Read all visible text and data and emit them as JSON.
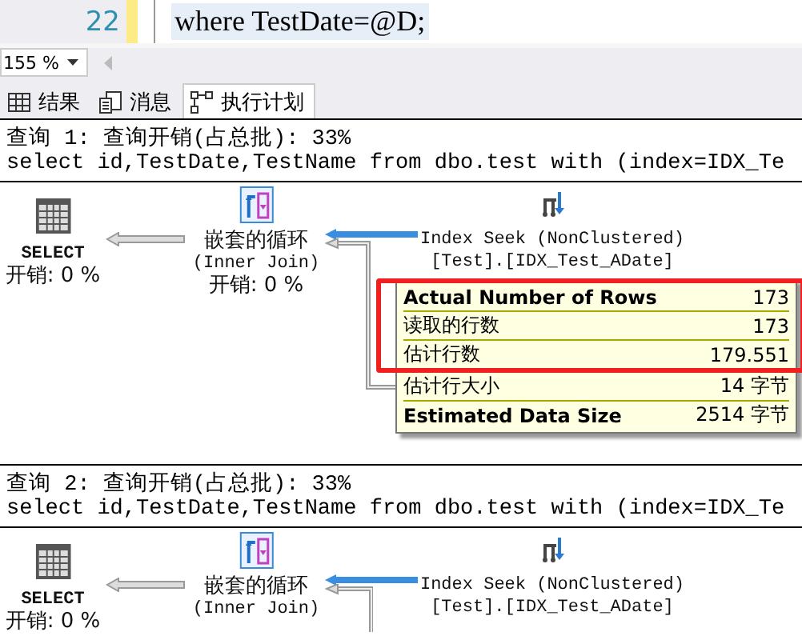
{
  "editor": {
    "line_number": "22",
    "code": "where TestDate=@D;"
  },
  "zoom": {
    "value": "155 %"
  },
  "tabs": [
    {
      "kind": "grid",
      "label": "结果",
      "selected": false
    },
    {
      "kind": "message",
      "label": "消息",
      "selected": false
    },
    {
      "kind": "plan",
      "label": "执行计划",
      "selected": true
    }
  ],
  "queries": [
    {
      "header": "查询 1: 查询开销(占总批): 33%",
      "sql": "select id,TestDate,TestName from dbo.test with (index=IDX_Te",
      "nodes": [
        {
          "kind": "select",
          "lines": [
            "SELECT",
            "开销: 0 %"
          ]
        },
        {
          "kind": "nested_loops",
          "lines": [
            "嵌套的循环",
            "(Inner Join)",
            "开销: 0 %"
          ]
        },
        {
          "kind": "index_seek",
          "lines": [
            "Index Seek (NonClustered)",
            "[Test].[IDX_Test_ADate]"
          ]
        }
      ],
      "tooltip": {
        "rows": [
          {
            "label": "Actual Number of Rows",
            "value": "173",
            "bold": true,
            "highlighted": true
          },
          {
            "label": "读取的行数",
            "value": "173",
            "bold": false,
            "highlighted": true
          },
          {
            "label": "估计行数",
            "value": "179.551",
            "bold": false,
            "highlighted": true
          },
          {
            "label": "估计行大小",
            "value": "14 字节",
            "bold": false,
            "highlighted": false
          },
          {
            "label": "Estimated Data Size",
            "value": "2514 字节",
            "bold": true,
            "highlighted": false
          }
        ]
      }
    },
    {
      "header": "查询 2: 查询开销(占总批): 33%",
      "sql": "select id,TestDate,TestName from dbo.test with (index=IDX_Te",
      "nodes": [
        {
          "kind": "select",
          "lines": [
            "SELECT",
            "开销: 0 %"
          ]
        },
        {
          "kind": "nested_loops",
          "lines": [
            "嵌套的循环",
            "(Inner Join)"
          ]
        },
        {
          "kind": "index_seek",
          "lines": [
            "Index Seek (NonClustered)",
            "[Test].[IDX_Test_ADate]"
          ]
        }
      ]
    }
  ]
}
